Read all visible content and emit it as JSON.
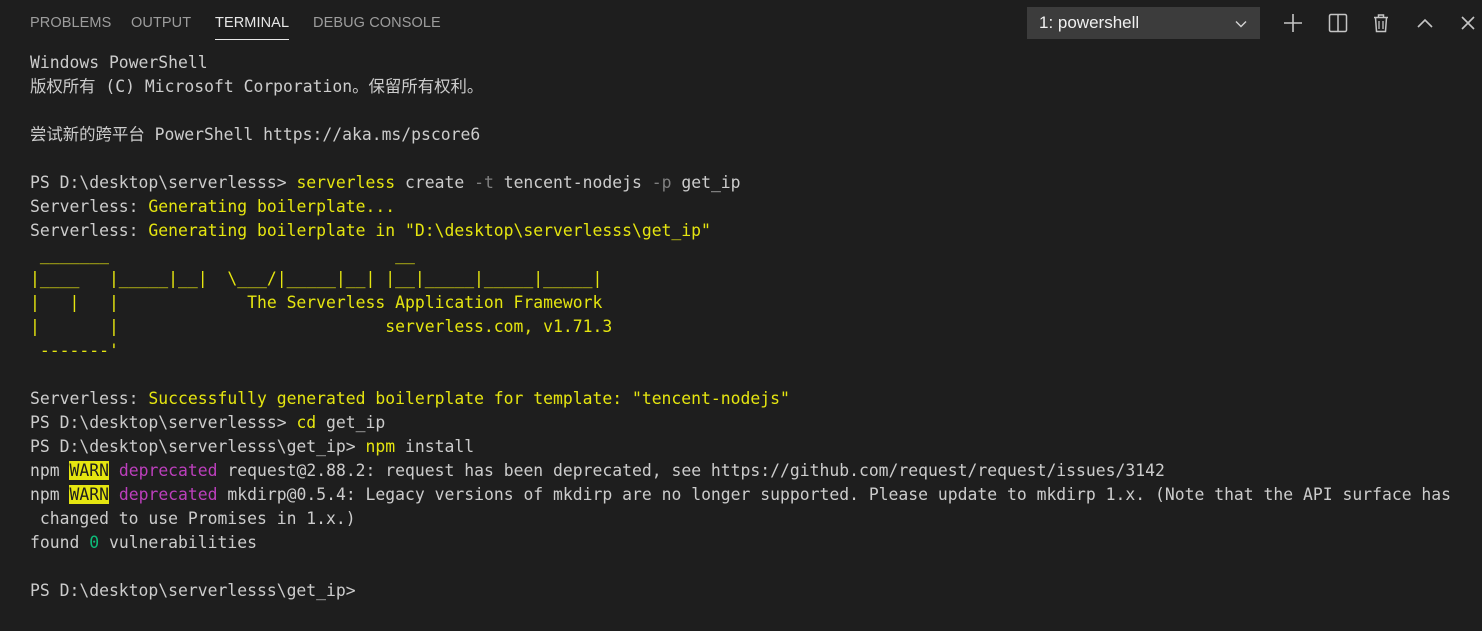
{
  "tabs": [
    {
      "label": "PROBLEMS",
      "active": false
    },
    {
      "label": "OUTPUT",
      "active": false
    },
    {
      "label": "TERMINAL",
      "active": true
    },
    {
      "label": "DEBUG CONSOLE",
      "active": false
    }
  ],
  "terminal_select": {
    "value": "1: powershell"
  },
  "toolbar": {
    "icons": [
      "plus-icon",
      "split-icon",
      "trash-icon",
      "chevron-up-icon",
      "close-icon"
    ]
  },
  "colors": {
    "background": "#1e1e1e",
    "text": "#cccccc",
    "yellow": "#e5e510",
    "green": "#0dbc79",
    "magenta": "#bc3fbc",
    "gray": "#808080"
  },
  "terminal": {
    "lines": [
      [
        {
          "t": "Windows PowerShell",
          "c": "default"
        }
      ],
      [
        {
          "t": "版权所有 (C) Microsoft Corporation。保留所有权利。",
          "c": "default"
        }
      ],
      [],
      [
        {
          "t": "尝试新的跨平台 PowerShell https://aka.ms/pscore6",
          "c": "default"
        }
      ],
      [],
      [
        {
          "t": "PS D:\\desktop\\serverlesss> ",
          "c": "default"
        },
        {
          "t": "serverless",
          "c": "yellow"
        },
        {
          "t": " create ",
          "c": "default"
        },
        {
          "t": "-t",
          "c": "gray"
        },
        {
          "t": " tencent-nodejs ",
          "c": "default"
        },
        {
          "t": "-p",
          "c": "gray"
        },
        {
          "t": " get_ip",
          "c": "default"
        }
      ],
      [
        {
          "t": "Serverless: ",
          "c": "default"
        },
        {
          "t": "Generating boilerplate...",
          "c": "yellow"
        }
      ],
      [
        {
          "t": "Serverless: ",
          "c": "default"
        },
        {
          "t": "Generating boilerplate in \"D:\\desktop\\serverlesss\\get_ip\"",
          "c": "yellow"
        }
      ],
      [
        {
          "t": " _______                             __",
          "c": "yellow"
        }
      ],
      [
        {
          "t": "|____   |_____|__|  \\___/|_____|__| |__|_____|_____|_____|",
          "c": "yellow"
        }
      ],
      [
        {
          "t": "|   |   |             The Serverless Application Framework",
          "c": "yellow"
        }
      ],
      [
        {
          "t": "|       |                           serverless.com, v1.71.3",
          "c": "yellow"
        }
      ],
      [
        {
          "t": " -------'",
          "c": "yellow"
        }
      ],
      [],
      [
        {
          "t": "Serverless: ",
          "c": "default"
        },
        {
          "t": "Successfully generated boilerplate for template: \"tencent-nodejs\"",
          "c": "yellow"
        }
      ],
      [
        {
          "t": "PS D:\\desktop\\serverlesss> ",
          "c": "default"
        },
        {
          "t": "cd",
          "c": "yellow"
        },
        {
          "t": " get_ip",
          "c": "default"
        }
      ],
      [
        {
          "t": "PS D:\\desktop\\serverlesss\\get_ip> ",
          "c": "default"
        },
        {
          "t": "npm",
          "c": "yellow"
        },
        {
          "t": " install",
          "c": "default"
        }
      ],
      [
        {
          "t": "npm ",
          "c": "default"
        },
        {
          "t": "WARN",
          "c": "warn"
        },
        {
          "t": " ",
          "c": "default"
        },
        {
          "t": "deprecated",
          "c": "magenta"
        },
        {
          "t": " request@2.88.2: request has been deprecated, see https://github.com/request/request/issues/3142",
          "c": "default"
        }
      ],
      [
        {
          "t": "npm ",
          "c": "default"
        },
        {
          "t": "WARN",
          "c": "warn"
        },
        {
          "t": " ",
          "c": "default"
        },
        {
          "t": "deprecated",
          "c": "magenta"
        },
        {
          "t": " mkdirp@0.5.4: Legacy versions of mkdirp are no longer supported. Please update to mkdirp 1.x. (Note that the API surface has",
          "c": "default"
        }
      ],
      [
        {
          "t": " changed to use Promises in 1.x.)",
          "c": "default"
        }
      ],
      [
        {
          "t": "found ",
          "c": "default"
        },
        {
          "t": "0",
          "c": "green"
        },
        {
          "t": " vulnerabilities",
          "c": "default"
        }
      ],
      [],
      [
        {
          "t": "PS D:\\desktop\\serverlesss\\get_ip>",
          "c": "default"
        }
      ]
    ]
  }
}
